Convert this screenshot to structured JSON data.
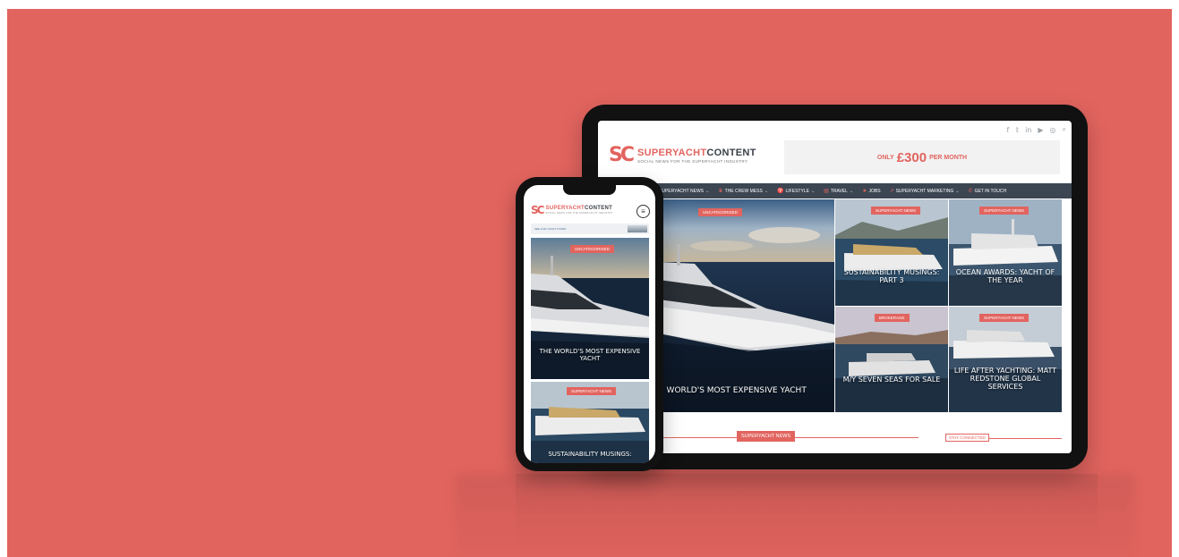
{
  "colors": {
    "background": "#e2645f",
    "accent": "#e2645f",
    "nav_bar": "#3c4652",
    "device_frame": "#111111"
  },
  "brand": {
    "brand_part1": "SUPERYACHT",
    "brand_part2": "CONTENT",
    "tagline": "SOCIAL NEWS FOR THE SUPERYACHT INDUSTRY",
    "logo_mark": "SC"
  },
  "tablet": {
    "social_icons": [
      {
        "icon": "facebook-icon",
        "glyph": "f"
      },
      {
        "icon": "twitter-icon",
        "glyph": "𝕥"
      },
      {
        "icon": "linkedin-icon",
        "glyph": "in"
      },
      {
        "icon": "youtube-icon",
        "glyph": "▶"
      },
      {
        "icon": "instagram-icon",
        "glyph": "◎"
      },
      {
        "icon": "search-icon",
        "glyph": "⌕"
      }
    ],
    "ad": {
      "pre": "ONLY",
      "price": "£300",
      "post": "PER MONTH"
    },
    "nav": [
      {
        "label": "SUPERYACHT NEWS",
        "icon": "",
        "caret": "⌄"
      },
      {
        "label": "THE CREW MESS",
        "icon": "♛",
        "caret": "⌄"
      },
      {
        "label": "LIFESTYLE",
        "icon": "♈",
        "caret": "⌄"
      },
      {
        "label": "TRAVEL",
        "icon": "▤",
        "caret": "⌄"
      },
      {
        "label": "JOBS",
        "icon": "★",
        "caret": ""
      },
      {
        "label": "SUPERYACHT MARKETING",
        "icon": "↗",
        "caret": "⌄"
      },
      {
        "label": "GET IN TOUCH",
        "icon": "✆",
        "caret": ""
      }
    ],
    "tiles": {
      "main": {
        "badge": "UNCATEGORISED",
        "caption": "E WORLD'S MOST EXPENSIVE YACHT"
      },
      "t1": {
        "badge": "SUPERYACHT NEWS",
        "caption": "SUSTAINABILITY MUSINGS: PART 3"
      },
      "t2": {
        "badge": "SUPERYACHT NEWS",
        "caption": "OCEAN AWARDS: YACHT OF THE YEAR"
      },
      "t3": {
        "badge": "BROKERAGE",
        "caption": "M/Y SEVEN SEAS FOR SALE"
      },
      "t4": {
        "badge": "SUPERYACHT NEWS",
        "caption": "LIFE AFTER YACHTING: MATT REDSTONE GLOBAL SERVICES"
      }
    },
    "section_title": "SUPERYACHT NEWS",
    "stay_connected": "STAY CONNECTED"
  },
  "phone": {
    "menu_glyph": "≡",
    "banner_text": "SEE LIVE YACHT TOURS",
    "tiles": [
      {
        "badge": "UNCATEGORISED",
        "caption": "THE WORLD'S MOST EXPENSIVE YACHT"
      },
      {
        "badge": "SUPERYACHT NEWS",
        "caption": "SUSTAINABILITY MUSINGS:"
      }
    ]
  }
}
